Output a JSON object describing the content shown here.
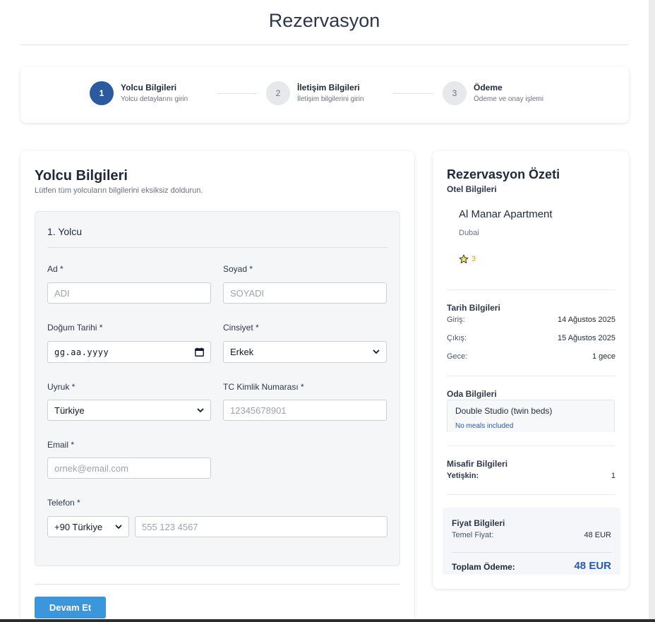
{
  "page": {
    "title": "Rezervasyon"
  },
  "stepper": {
    "steps": [
      {
        "number": "1",
        "title": "Yolcu Bilgileri",
        "subtitle": "Yolcu detaylarını girin"
      },
      {
        "number": "2",
        "title": "İletişim Bilgileri",
        "subtitle": "İletişim bilgilerini girin"
      },
      {
        "number": "3",
        "title": "Ödeme",
        "subtitle": "Ödeme ve onay işlemi"
      }
    ]
  },
  "form": {
    "title": "Yolcu Bilgileri",
    "subtitle": "Lütfen tüm yolcuların bilgilerini eksiksiz doldurun.",
    "passenger_title": "1. Yolcu",
    "fields": {
      "first_name": {
        "label": "Ad *",
        "placeholder": "ADI"
      },
      "last_name": {
        "label": "Soyad *",
        "placeholder": "SOYADI"
      },
      "birth_date": {
        "label": "Doğum Tarihi *",
        "mask": "gg.aa.yyyy"
      },
      "gender": {
        "label": "Cinsiyet *",
        "value": "Erkek"
      },
      "nationality": {
        "label": "Uyruk *",
        "value": "Türkiye"
      },
      "tc_no": {
        "label": "TC Kimlik Numarası *",
        "placeholder": "12345678901"
      },
      "email": {
        "label": "Email *",
        "placeholder": "ornek@email.com"
      },
      "phone": {
        "label": "Telefon *",
        "country_code": "+90 Türkiye",
        "placeholder": "555 123 4567"
      }
    },
    "next_button": "Devam Et"
  },
  "summary": {
    "title": "Rezervasyon Özeti",
    "hotel_section": "Otel Bilgileri",
    "hotel_name": "Al Manar Apartment",
    "hotel_city": "Dubai",
    "stars": "3",
    "dates_section": "Tarih Bilgileri",
    "checkin_label": "Giriş:",
    "checkin_value": "14 Ağustos 2025",
    "checkout_label": "Çıkış:",
    "checkout_value": "15 Ağustos 2025",
    "nights_label": "Gece:",
    "nights_value": "1 gece",
    "room_section": "Oda Bilgileri",
    "room_name": "Double Studio (twin beds)",
    "room_meal": "No meals included",
    "guest_section": "Misafir Bilgileri",
    "adult_label": "Yetişkin:",
    "adult_value": "1",
    "price_section": "Fiyat Bilgileri",
    "base_price_label": "Temel Fiyat:",
    "base_price_value": "48 EUR",
    "total_label": "Toplam Ödeme:",
    "total_value": "48 EUR"
  },
  "colors": {
    "primary": "#2c5aa0",
    "button": "#3b96db",
    "star": "#d69e2e"
  }
}
